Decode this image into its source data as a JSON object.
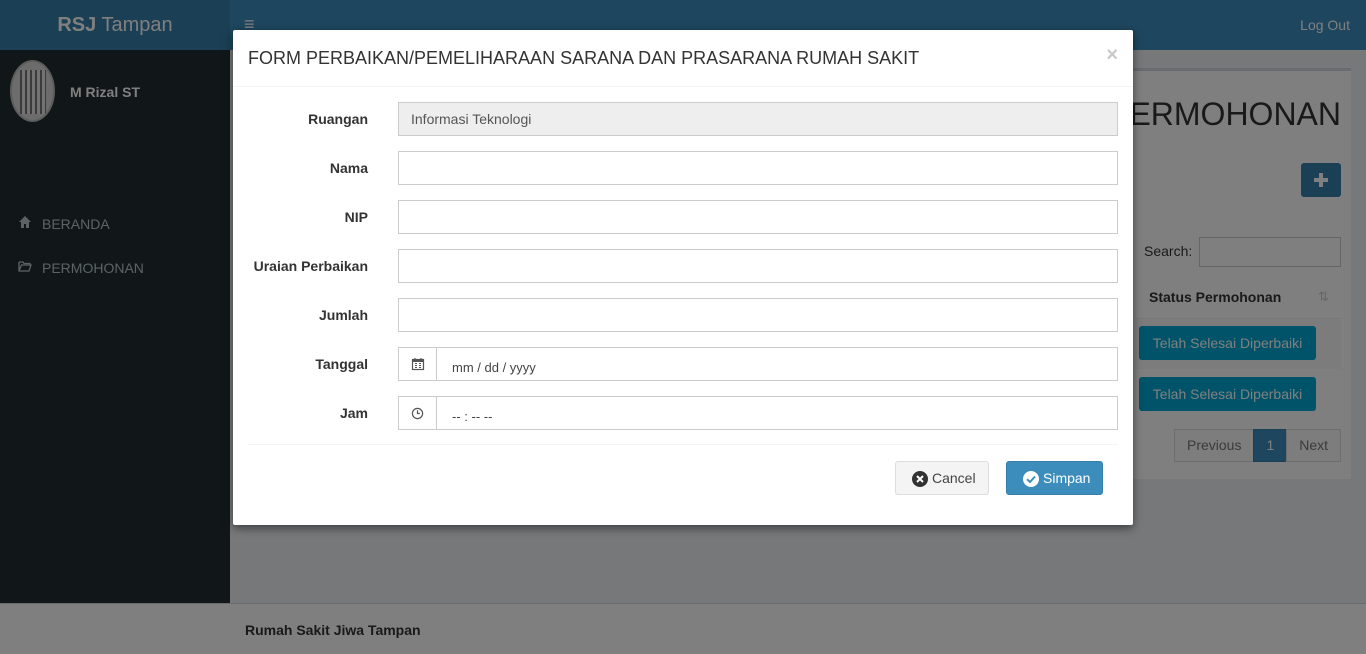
{
  "app": {
    "logo_bold": "RSJ",
    "logo_rest": " Tampan",
    "logout": "Log Out",
    "user_name": "M Rizal ST"
  },
  "sidebar": {
    "items": [
      {
        "label": "BERANDA",
        "icon": "home-icon"
      },
      {
        "label": "PERMOHONAN",
        "icon": "folder-open-icon"
      }
    ]
  },
  "main": {
    "heading_visible": "PERMOHONAN",
    "search_label": "Search:",
    "search_value": "",
    "column_header": "Status Permohonan",
    "rows": [
      {
        "status": "Telah Selesai Diperbaiki"
      },
      {
        "status": "Telah Selesai Diperbaiki"
      }
    ],
    "pagination": {
      "previous": "Previous",
      "page": "1",
      "next": "Next"
    }
  },
  "footer": {
    "text": "Rumah Sakit Jiwa Tampan"
  },
  "modal": {
    "title": "FORM PERBAIKAN/PEMELIHARAAN SARANA DAN PRASARANA RUMAH SAKIT",
    "close": "×",
    "fields": {
      "ruangan": {
        "label": "Ruangan",
        "value": "Informasi Teknologi"
      },
      "nama": {
        "label": "Nama",
        "value": ""
      },
      "nip": {
        "label": "NIP",
        "value": ""
      },
      "uraian": {
        "label": "Uraian Perbaikan",
        "value": ""
      },
      "jumlah": {
        "label": "Jumlah",
        "value": ""
      },
      "tanggal": {
        "label": "Tanggal",
        "placeholder": "mm / dd / yyyy",
        "icon": "calendar-icon"
      },
      "jam": {
        "label": "Jam",
        "placeholder": "-- : --   --",
        "icon": "clock-icon"
      }
    },
    "buttons": {
      "cancel": "Cancel",
      "save": "Simpan"
    }
  },
  "colors": {
    "header": "#3c8dbc",
    "logo_bg": "#367fa9",
    "sidebar": "#222d32",
    "info_button": "#00a7d0",
    "primary": "#3c8dbc"
  }
}
